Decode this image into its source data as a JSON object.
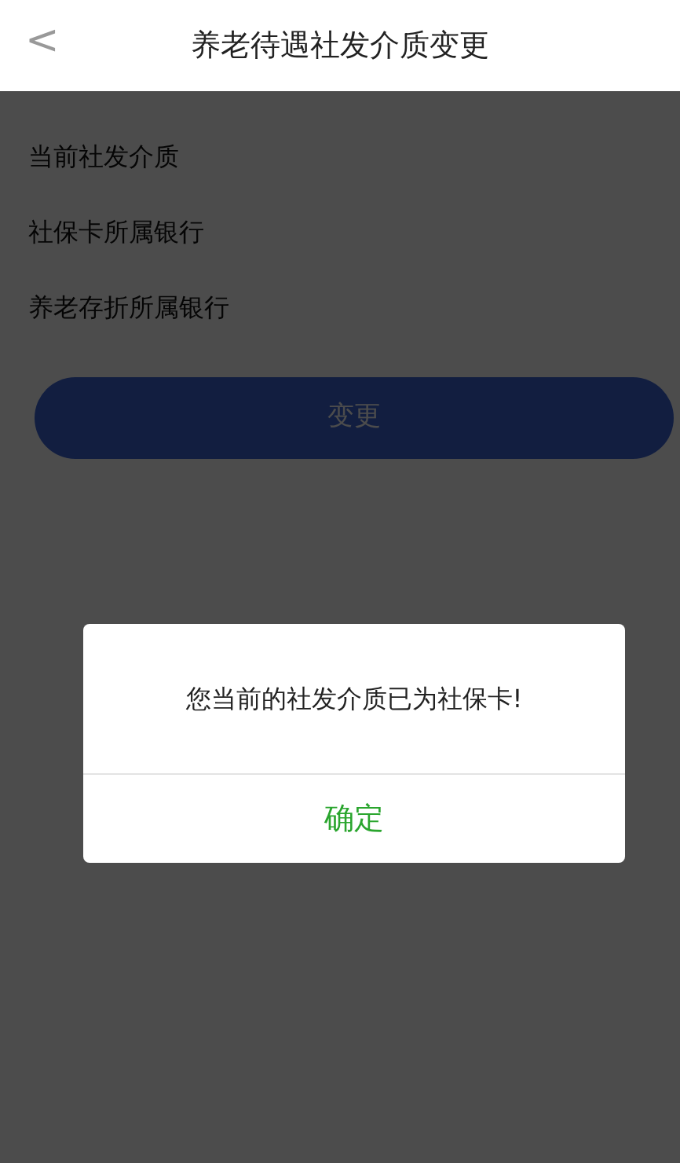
{
  "header": {
    "back": "<",
    "title": "养老待遇社发介质变更"
  },
  "fields": [
    {
      "label": "当前社发介质"
    },
    {
      "label": "社保卡所属银行"
    },
    {
      "label": "养老存折所属银行"
    }
  ],
  "action_button": {
    "label": "变更"
  },
  "dialog": {
    "message": "您当前的社发介质已为社保卡!",
    "confirm": "确定"
  }
}
